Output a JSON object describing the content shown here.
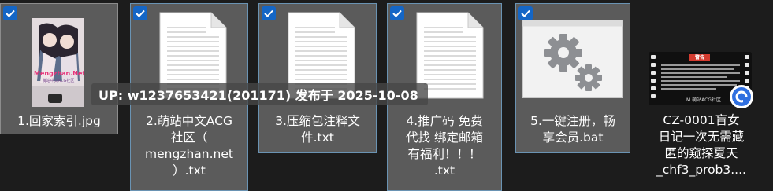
{
  "overlay": {
    "uploader_text": "UP: w1237653421(201171) 发布于 2025-10-08"
  },
  "files": [
    {
      "name": "1.回家索引.jpg",
      "selected": true
    },
    {
      "name": "2.萌站中文ACG\n社区（\nmengzhan.net\n）.txt",
      "selected": true
    },
    {
      "name": "3.压缩包注释文\n件.txt",
      "selected": true
    },
    {
      "name": "4.推广码 免费\n代找 绑定邮箱\n有福利！！！\n.txt",
      "selected": true
    },
    {
      "name": "5.一键注册，畅\n享会员.bat",
      "selected": true
    },
    {
      "name": "CZ-0001盲女\n日记一次无需藏\n匿的窥探夏天\n_chf3_prob3....",
      "selected": false
    }
  ],
  "thumbnail_text": {
    "poster_site": "Mengzhan.Net",
    "poster_sub": "萌站中文ACG社区",
    "video_title": "警告",
    "video_footer": "M 萌站ACG社区"
  },
  "colors": {
    "accent": "#1466c6",
    "tile_selected": "#5b5b5b",
    "background": "#1c1c1c"
  },
  "icons": {
    "check": "checkmark-icon",
    "text_file": "text-document-icon",
    "app": "gears-icon",
    "video": "video-filmstrip-icon",
    "badge": "cloud-sync-icon"
  }
}
